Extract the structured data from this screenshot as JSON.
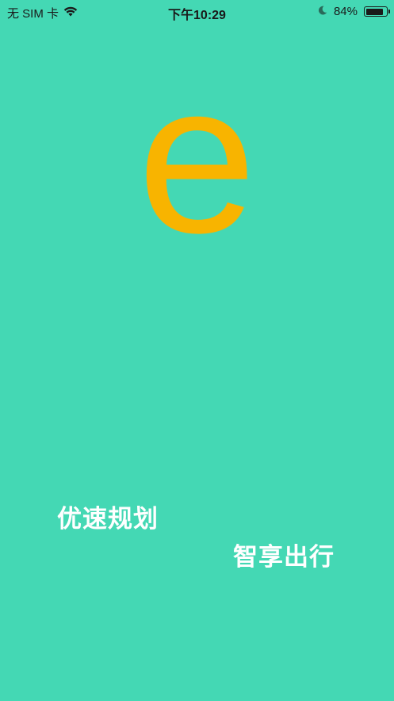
{
  "status_bar": {
    "carrier": "无 SIM 卡",
    "time": "下午10:29",
    "battery_percent": "84%",
    "battery_level": 0.84,
    "icons": {
      "wifi": "wifi-icon",
      "moon": "moon-icon",
      "battery": "battery-icon"
    }
  },
  "splash": {
    "logo_letter": "e",
    "slogan_line1": "优速规划",
    "slogan_line2": "智享出行"
  },
  "colors": {
    "background": "#44d8b4",
    "logo": "#f8b400",
    "slogan": "#ffffff"
  }
}
